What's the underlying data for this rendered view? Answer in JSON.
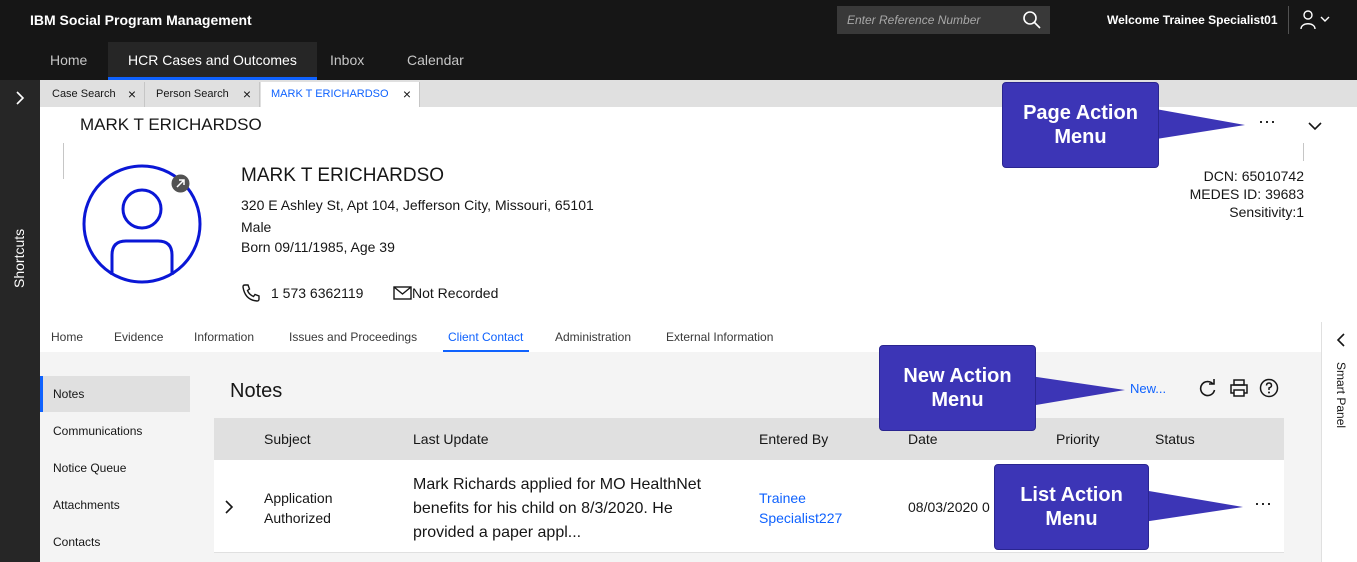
{
  "header": {
    "brand": "IBM Social Program Management",
    "search_placeholder": "Enter Reference Number",
    "welcome": "Welcome Trainee Specialist01"
  },
  "nav": [
    "Home",
    "HCR Cases and Outcomes",
    "Inbox",
    "Calendar"
  ],
  "rail": {
    "label": "Shortcuts"
  },
  "tabs": [
    {
      "label": "Case Search"
    },
    {
      "label": "Person Search"
    },
    {
      "label": "MARK T ERICHARDSO"
    }
  ],
  "page": {
    "title": "MARK T ERICHARDSO",
    "more_icon": "⋯"
  },
  "person": {
    "name": "MARK T ERICHARDSO",
    "address": "320 E Ashley St, Apt 104, Jefferson City, Missouri, 65101",
    "gender": "Male",
    "born": "Born 09/11/1985, Age 39",
    "phone": "1 573 6362119",
    "email": "Not Recorded",
    "dcn": "DCN: 65010742",
    "medes": "MEDES ID: 39683",
    "sensitivity": "Sensitivity:1"
  },
  "subtabs": [
    "Home",
    "Evidence",
    "Information",
    "Issues and Proceedings",
    "Client Contact",
    "Administration",
    "External Information"
  ],
  "sidenav": [
    "Notes",
    "Communications",
    "Notice Queue",
    "Attachments",
    "Contacts"
  ],
  "notes": {
    "title": "Notes",
    "new_label": "New...",
    "columns": [
      "Subject",
      "Last Update",
      "Entered By",
      "Date",
      "Priority",
      "Status"
    ],
    "row": {
      "subject_1": "Application",
      "subject_2": "Authorized",
      "update_1": "Mark Richards applied for MO HealthNet",
      "update_2": "benefits for his child on 8/3/2020. He",
      "update_3": "provided a paper appl...",
      "entered_1": "Trainee",
      "entered_2": "Specialist227",
      "date": "08/03/2020 0"
    }
  },
  "smart_panel": {
    "label": "Smart Panel"
  },
  "callouts": {
    "page_action_1": "Page Action",
    "page_action_2": "Menu",
    "new_action_1": "New Action",
    "new_action_2": "Menu",
    "list_action_1": "List Action",
    "list_action_2": "Menu"
  },
  "colors": {
    "accent": "#0f62fe",
    "callout": "#3c35b6",
    "header_bg": "#161616"
  }
}
